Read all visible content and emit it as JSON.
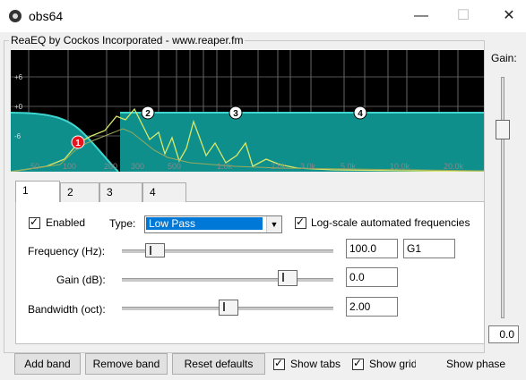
{
  "window": {
    "title": "obs64",
    "minimize": "—",
    "maximize": "☐",
    "close": "✕"
  },
  "group_title": "ReaEQ by Cockos Incorporated - www.reaper.fm",
  "graph": {
    "db_labels": [
      "+6",
      "+0",
      "-6"
    ],
    "freq_labels": [
      "50",
      "100",
      "200",
      "300",
      "500",
      "1.0k",
      "2.0k",
      "3.0k",
      "5.0k",
      "10.0k",
      "20.0k"
    ],
    "band_markers": [
      "1",
      "2",
      "3",
      "4"
    ],
    "colors": {
      "fill": "#0f8f8c",
      "curve": "#3fd6d0",
      "marker_active": "#e8141e",
      "spectrum": "#d8e86a"
    }
  },
  "tabs": [
    "1",
    "2",
    "3",
    "4"
  ],
  "band": {
    "enabled_label": "Enabled",
    "enabled": true,
    "type_label": "Type:",
    "type_value": "Low Pass",
    "logscale_label": "Log-scale automated frequencies",
    "logscale": true,
    "frequency_label": "Frequency (Hz):",
    "frequency_value": "100.0",
    "frequency_note": "G1",
    "gain_label": "Gain (dB):",
    "gain_value": "0.0",
    "bandwidth_label": "Bandwidth (oct):",
    "bandwidth_value": "2.00"
  },
  "buttons": {
    "add_band": "Add band",
    "remove_band": "Remove band",
    "reset_defaults": "Reset defaults"
  },
  "checks": {
    "show_tabs": "Show tabs",
    "show_grid": "Show grid",
    "show_phase": "Show phase",
    "show_tabs_checked": true,
    "show_grid_checked": true
  },
  "master_gain": {
    "label": "Gain:",
    "value": "0.0"
  }
}
